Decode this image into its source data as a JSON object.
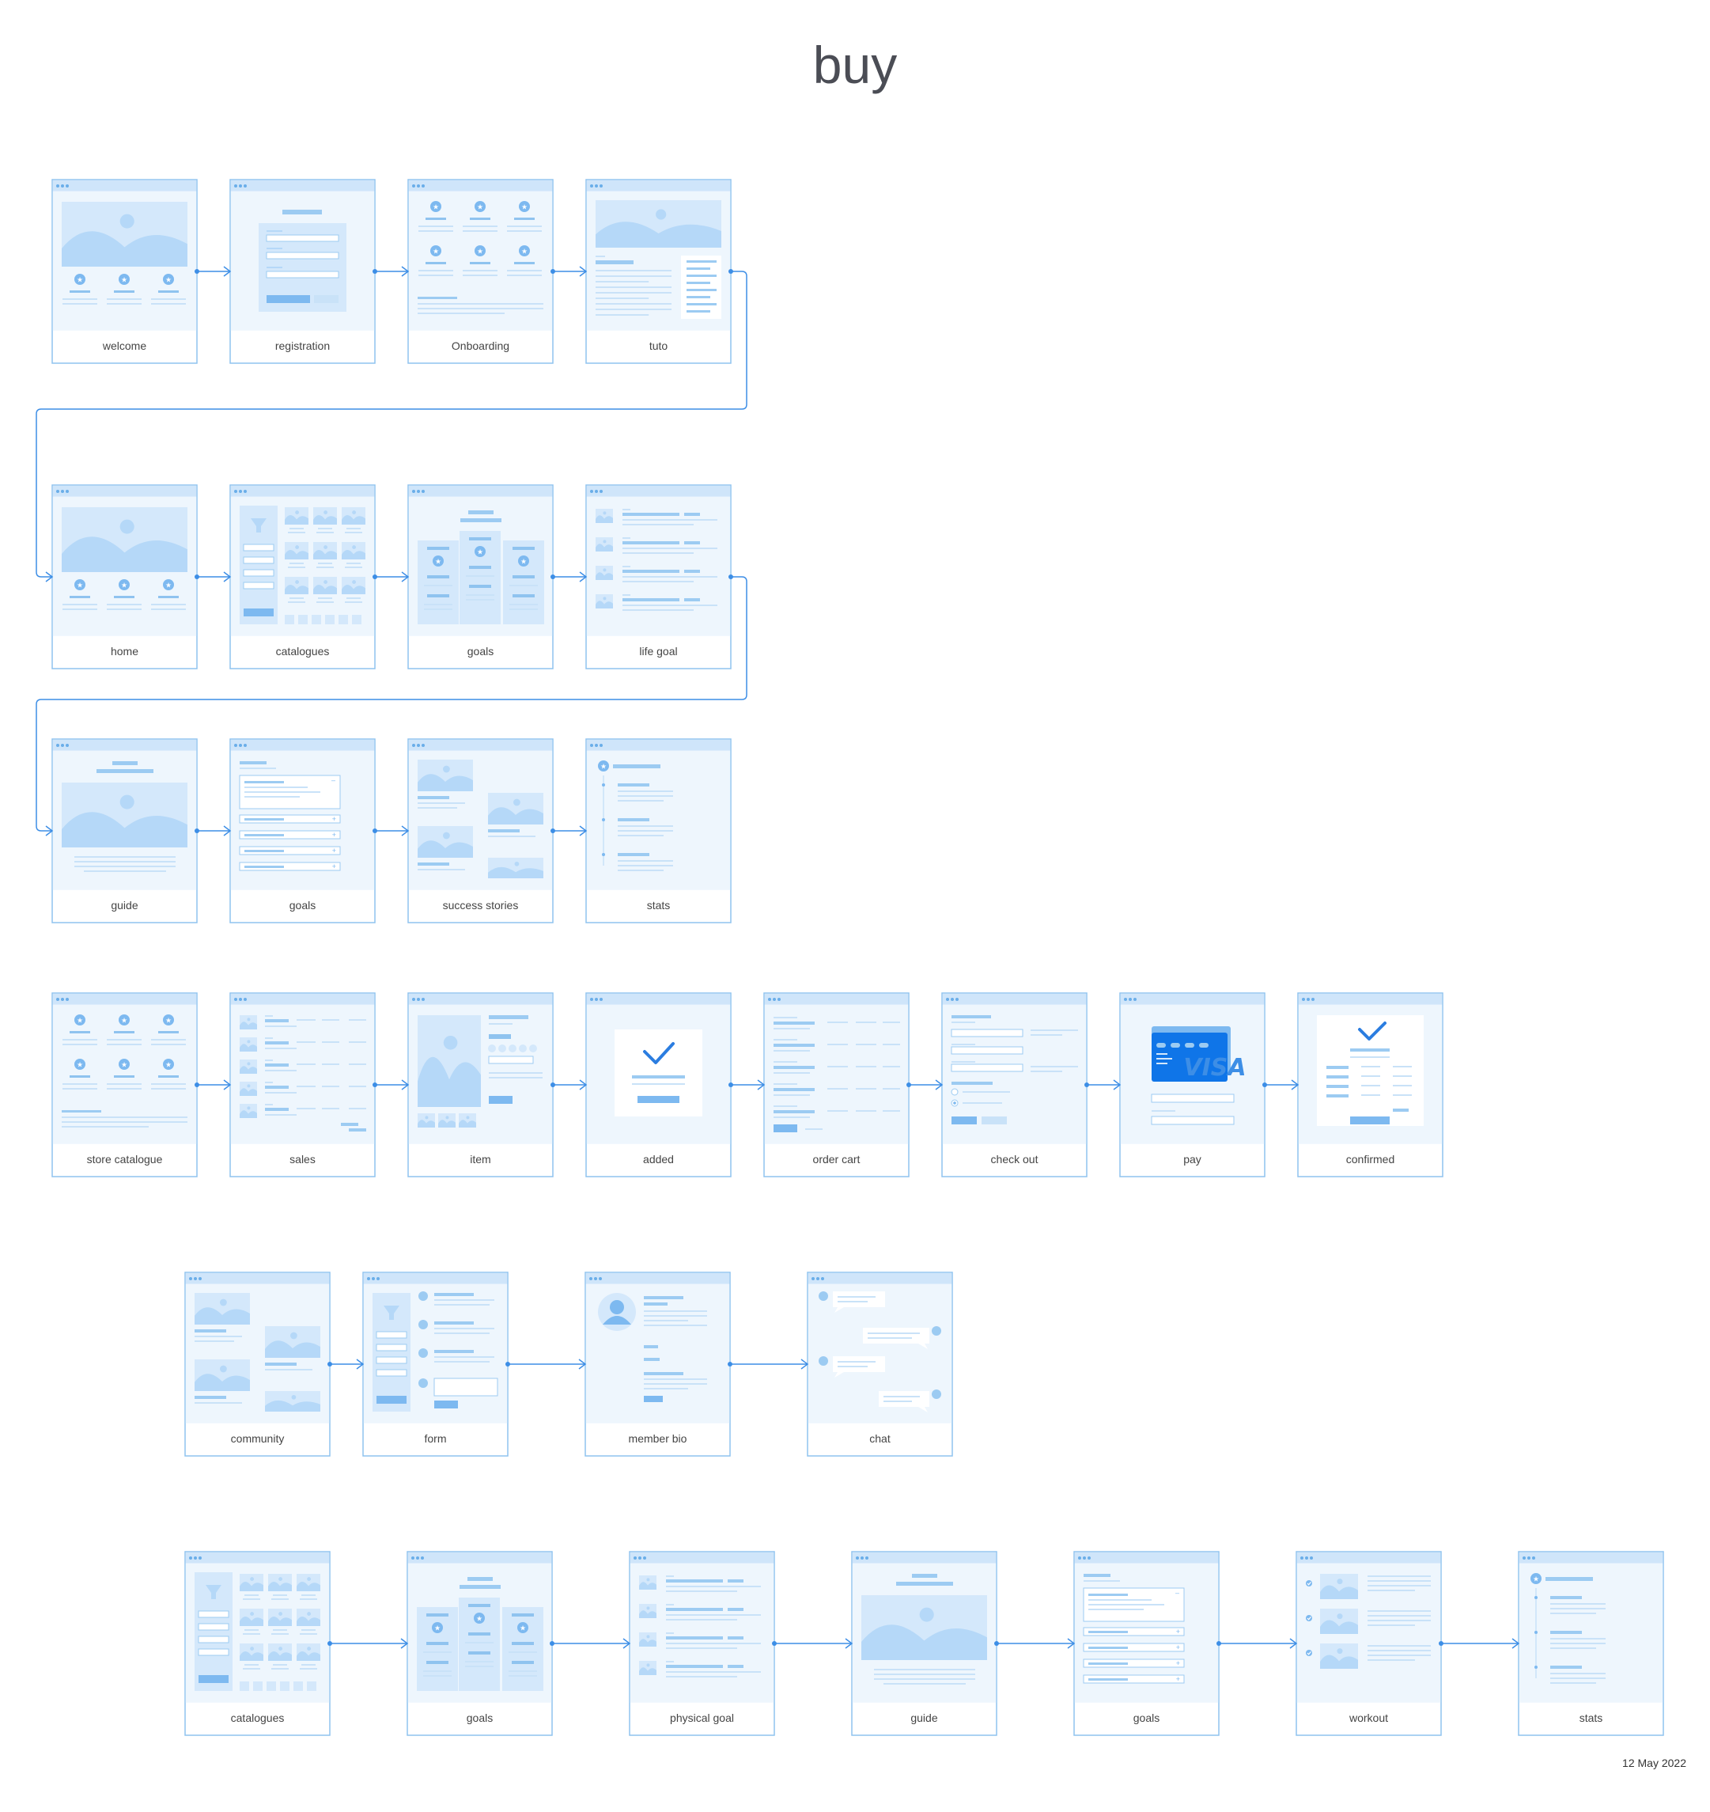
{
  "title": "buy",
  "date": "12 May 2022",
  "colors": {
    "frame": "#8fc3ef",
    "panel": "#eef6fd",
    "fill": "#b5d8f8",
    "accent": "#2b7de0",
    "arrow": "#3d8ee6",
    "card": "#0f75e8"
  },
  "rows": [
    {
      "screens": [
        {
          "label": "welcome",
          "icon": "hero-features-wireframe"
        },
        {
          "label": "registration",
          "icon": "form-wireframe"
        },
        {
          "label": "Onboarding",
          "icon": "feature-grid-wireframe"
        },
        {
          "label": "tuto",
          "icon": "hero-article-wireframe"
        }
      ]
    },
    {
      "screens": [
        {
          "label": "home",
          "icon": "hero-features-wireframe"
        },
        {
          "label": "catalogues",
          "icon": "filter-catalogue-wireframe"
        },
        {
          "label": "goals",
          "icon": "pricing-columns-wireframe"
        },
        {
          "label": "life goal",
          "icon": "media-list-wireframe"
        }
      ]
    },
    {
      "screens": [
        {
          "label": "guide",
          "icon": "hero-text-wireframe"
        },
        {
          "label": "goals",
          "icon": "accordion-wireframe"
        },
        {
          "label": "success stories",
          "icon": "image-stories-wireframe"
        },
        {
          "label": "stats",
          "icon": "timeline-wireframe"
        }
      ]
    },
    {
      "screens": [
        {
          "label": "store catalogue",
          "icon": "feature-grid-wireframe"
        },
        {
          "label": "sales",
          "icon": "product-rows-wireframe"
        },
        {
          "label": "item",
          "icon": "product-detail-wireframe"
        },
        {
          "label": "added",
          "icon": "check-dialog-wireframe"
        },
        {
          "label": "order cart",
          "icon": "cart-table-wireframe"
        },
        {
          "label": "check out",
          "icon": "checkout-form-wireframe"
        },
        {
          "label": "pay",
          "icon": "credit-card-wireframe"
        },
        {
          "label": "confirmed",
          "icon": "receipt-check-wireframe"
        }
      ]
    },
    {
      "screens": [
        {
          "label": "community",
          "icon": "image-stories-wireframe"
        },
        {
          "label": "form",
          "icon": "filter-comments-wireframe"
        },
        {
          "label": "member bio",
          "icon": "profile-wireframe"
        },
        {
          "label": "chat",
          "icon": "chat-bubbles-wireframe"
        }
      ]
    },
    {
      "screens": [
        {
          "label": "catalogues",
          "icon": "filter-catalogue-wireframe"
        },
        {
          "label": "goals",
          "icon": "pricing-columns-wireframe"
        },
        {
          "label": "physical goal",
          "icon": "media-list-wireframe"
        },
        {
          "label": "guide",
          "icon": "hero-text-wireframe"
        },
        {
          "label": "goals",
          "icon": "accordion-wireframe"
        },
        {
          "label": "workout",
          "icon": "checklist-wireframe"
        },
        {
          "label": "stats",
          "icon": "timeline-wireframe"
        }
      ]
    }
  ]
}
